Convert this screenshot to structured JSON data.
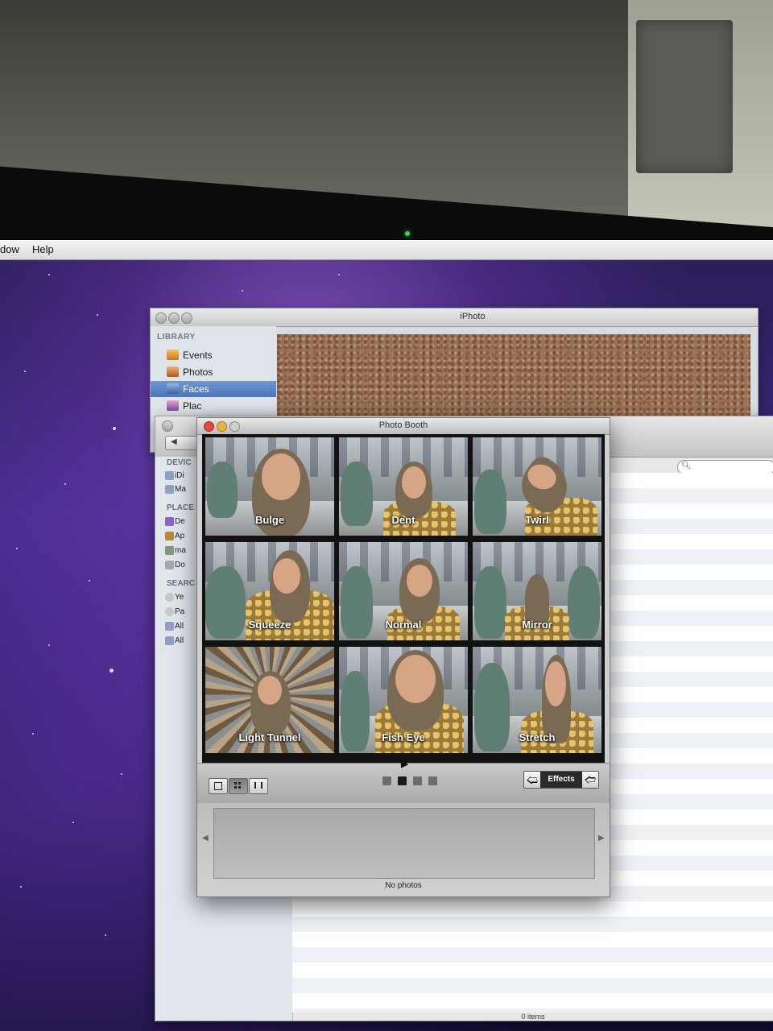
{
  "menubar": {
    "item_window_partial": "dow",
    "item_help": "Help"
  },
  "iphoto": {
    "title": "iPhoto",
    "library_header": "LIBRARY",
    "items": [
      {
        "label": "Events",
        "icon": "events-icon",
        "selected": false
      },
      {
        "label": "Photos",
        "icon": "photos-icon",
        "selected": false
      },
      {
        "label": "Faces",
        "icon": "faces-icon",
        "selected": true
      },
      {
        "label": "Plac",
        "icon": "places-icon",
        "selected": false
      }
    ]
  },
  "finder": {
    "sections": [
      {
        "header": "DEVIC",
        "items": [
          "iDi",
          "Ma"
        ]
      },
      {
        "header": "PLACE",
        "items": [
          "De",
          "Ap",
          "ma",
          "Do"
        ]
      },
      {
        "header": "SEARC",
        "items": [
          "Ye",
          "Pa",
          "All",
          "All"
        ]
      }
    ],
    "status": "0 items"
  },
  "photobooth": {
    "title": "Photo Booth",
    "effects": [
      "Bulge",
      "Dent",
      "Twirl",
      "Squeeze",
      "Normal",
      "Mirror",
      "Light Tunnel",
      "Fish Eye",
      "Stretch"
    ],
    "view_modes": [
      "single-view",
      "grid-view",
      "filmstrip-view"
    ],
    "selected_view": "grid-view",
    "page_count": 4,
    "current_page": 2,
    "effects_button_label": "Effects",
    "tray_status": "No photos"
  },
  "colors": {
    "close_red": "#e04a3f",
    "minimize_yellow": "#e9b341",
    "selection_blue": "#4c76b8"
  }
}
